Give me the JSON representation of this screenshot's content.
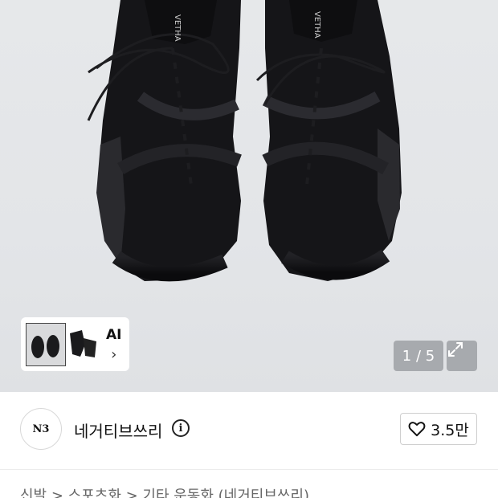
{
  "gallery": {
    "thumbnail_label": "AI",
    "counter": "1 / 5",
    "tongue_text": "VETHA"
  },
  "seller": {
    "avatar_text": "N3",
    "name": "네거티브쓰리",
    "like_count": "3.5만"
  },
  "breadcrumb": "신발 > 스포츠화 > 기타 운동화 (네거티브쓰리)",
  "colors": {
    "shoe": "#17171a",
    "backdrop": "#e4e6e9"
  }
}
